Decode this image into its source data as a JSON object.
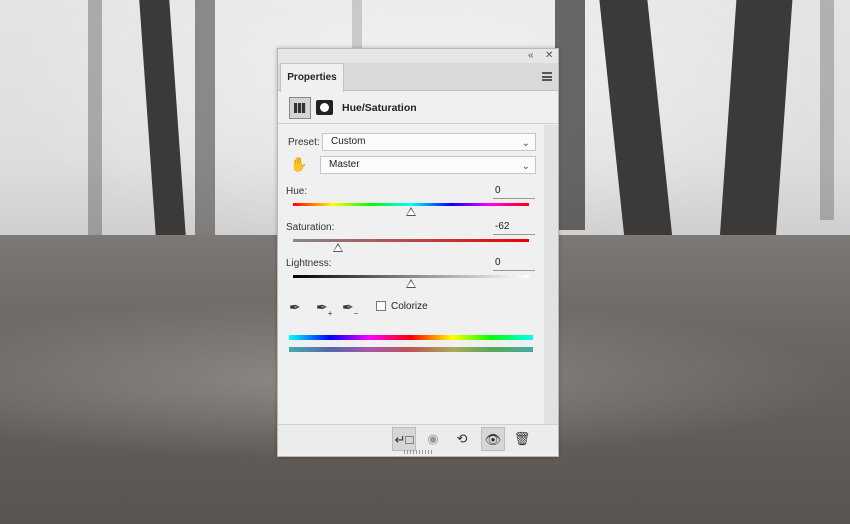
{
  "panel": {
    "tab_label": "Properties",
    "adjustment_title": "Hue/Saturation"
  },
  "preset": {
    "label": "Preset:",
    "value": "Custom"
  },
  "channel": {
    "value": "Master"
  },
  "hue": {
    "label": "Hue:",
    "value": "0",
    "level": 0.5
  },
  "saturation": {
    "label": "Saturation:",
    "value": "-62",
    "level": 0.19
  },
  "lightness": {
    "label": "Lightness:",
    "value": "0",
    "level": 0.5
  },
  "colorize": {
    "label": "Colorize",
    "checked": false
  },
  "icons": {
    "collapse": "double-chevron-left-icon",
    "close": "close-icon",
    "menu": "panel-menu-icon",
    "adjustment": "hue-saturation-icon",
    "mask": "layer-mask-icon",
    "target": "targeted-adjustment-hand-icon",
    "eyedropper": "eyedropper-icon",
    "eyedropper_add": "eyedropper-add-icon",
    "eyedropper_subtract": "eyedropper-subtract-icon",
    "clip": "clip-to-layer-icon",
    "view_previous": "view-previous-state-icon",
    "reset": "reset-icon",
    "visibility": "visibility-eye-icon",
    "delete": "trash-icon"
  }
}
